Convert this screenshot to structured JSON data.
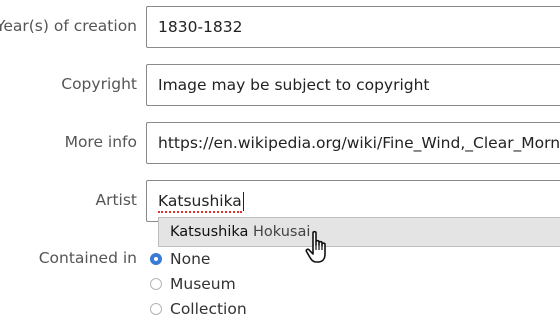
{
  "form": {
    "year": {
      "label": "Year(s) of creation",
      "value": "1830-1832"
    },
    "copyright": {
      "label": "Copyright",
      "value": "Image may be subject to copyright"
    },
    "more_info": {
      "label": "More info",
      "value": "https://en.wikipedia.org/wiki/Fine_Wind,_Clear_Morning"
    },
    "artist": {
      "label": "Artist",
      "value": "Katsushika",
      "suggestion": {
        "match": "Katsushika",
        "rest": " Hokusai"
      }
    },
    "contained_in": {
      "label": "Contained in",
      "selected": "None",
      "options": [
        "None",
        "Museum",
        "Collection"
      ]
    }
  },
  "icons": {
    "pointer": "hand-pointer-icon"
  },
  "colors": {
    "radio_selected": "#3a7bd5",
    "spellcheck": "#e03030"
  }
}
